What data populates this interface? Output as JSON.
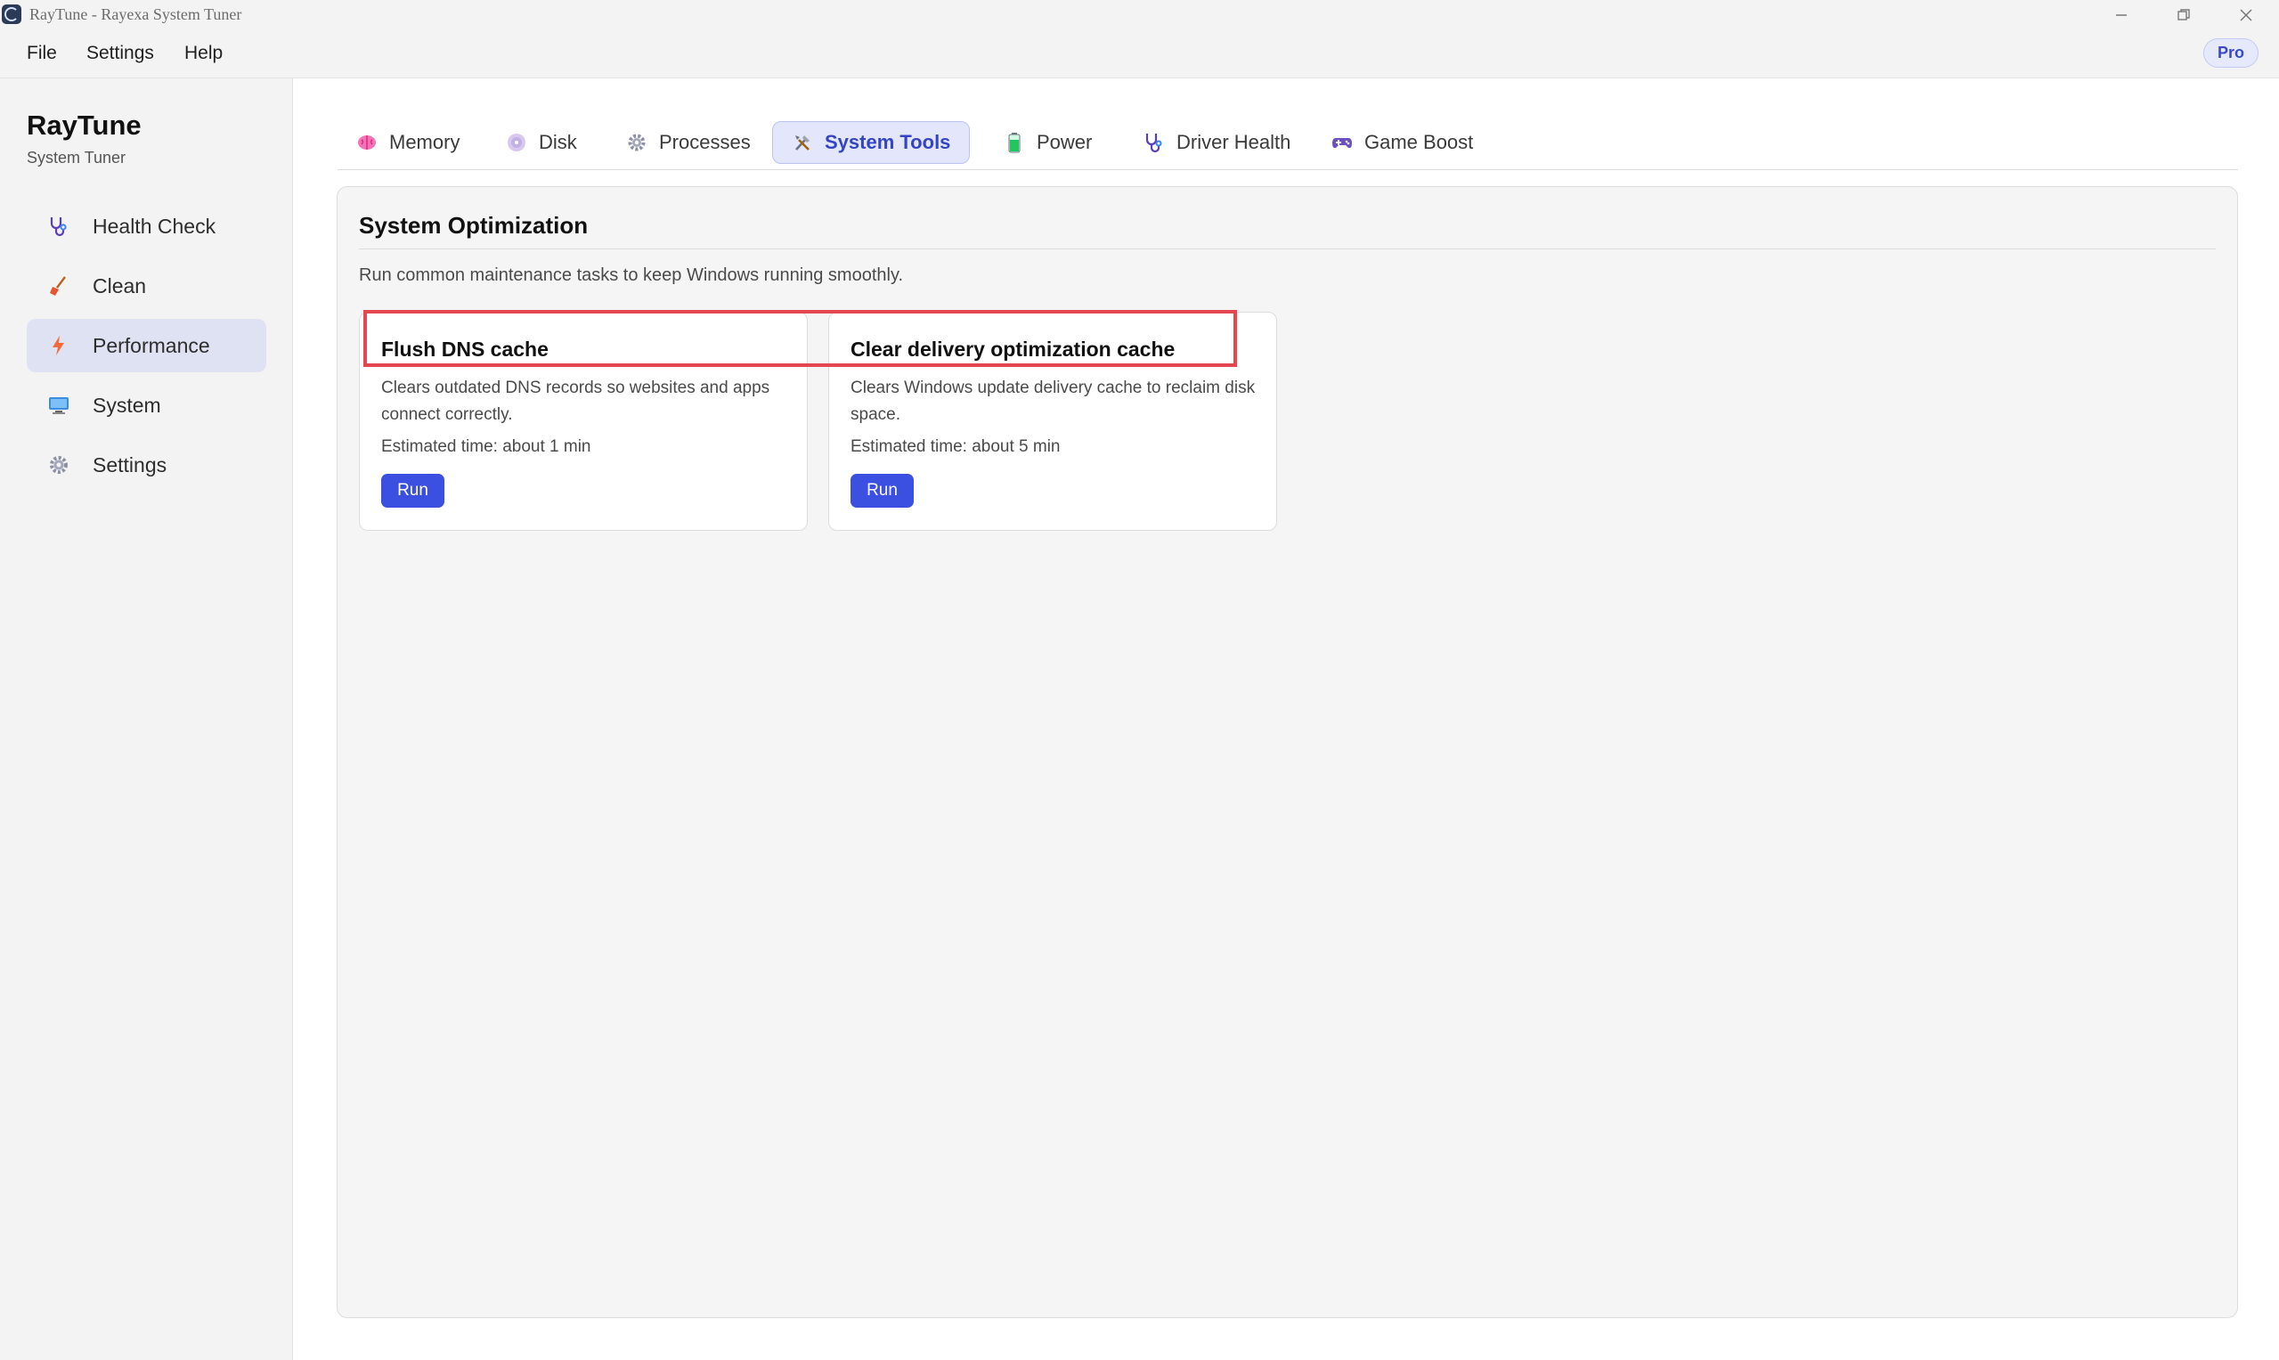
{
  "window": {
    "title": "RayTune - Rayexa System Tuner",
    "minimize_icon": "minimize-icon",
    "maximize_icon": "restore-icon",
    "close_icon": "close-icon"
  },
  "menu": {
    "items": [
      {
        "label": "File"
      },
      {
        "label": "Settings"
      },
      {
        "label": "Help"
      }
    ],
    "badge": "Pro"
  },
  "sidebar": {
    "brand": "RayTune",
    "subtitle": "System Tuner",
    "items": [
      {
        "label": "Health Check",
        "icon": "stethoscope-icon",
        "active": false
      },
      {
        "label": "Clean",
        "icon": "broom-icon",
        "active": false
      },
      {
        "label": "Performance",
        "icon": "lightning-icon",
        "active": true
      },
      {
        "label": "System",
        "icon": "monitor-icon",
        "active": false
      },
      {
        "label": "Settings",
        "icon": "gear-icon",
        "active": false
      }
    ]
  },
  "tabs": [
    {
      "label": "Memory",
      "icon": "brain-icon",
      "active": false
    },
    {
      "label": "Disk",
      "icon": "disk-icon",
      "active": false
    },
    {
      "label": "Processes",
      "icon": "gear-icon",
      "active": false
    },
    {
      "label": "System Tools",
      "icon": "tools-icon",
      "active": true
    },
    {
      "label": "Power",
      "icon": "battery-icon",
      "active": false
    },
    {
      "label": "Driver Health",
      "icon": "stethoscope-icon",
      "active": false
    },
    {
      "label": "Game Boost",
      "icon": "gamepad-icon",
      "active": false
    }
  ],
  "panel": {
    "title": "System Optimization",
    "description": "Run common maintenance tasks to keep Windows running smoothly.",
    "cards": [
      {
        "title": "Flush DNS cache",
        "description": "Clears outdated DNS records so websites and apps connect correctly.",
        "time": "Estimated time: about 1 min",
        "button": "Run"
      },
      {
        "title": "Clear delivery optimization cache",
        "description": "Clears Windows update delivery cache to reclaim disk space.",
        "time": "Estimated time: about 5 min",
        "button": "Run"
      }
    ]
  },
  "colors": {
    "accent": "#3b4fe0",
    "highlight": "#e4474f",
    "active_bg": "#dfe2f2"
  }
}
